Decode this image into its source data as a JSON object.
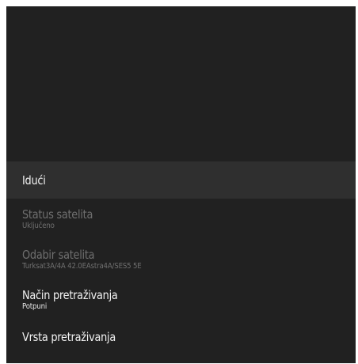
{
  "menu": {
    "items": [
      {
        "title": "Idući",
        "subtitle": "",
        "state": "focused"
      },
      {
        "title": "Status satelita",
        "subtitle": "Uključeno",
        "state": "disabled"
      },
      {
        "title": "Odabir satelita",
        "subtitle": "Turksat3A/4A 42.0EAstra4A/SES5 5E",
        "state": "disabled"
      },
      {
        "title": "Način pretraživanja",
        "subtitle": "Potpuni",
        "state": "enabled"
      },
      {
        "title": "Vrsta pretraživanja",
        "subtitle": "",
        "state": "enabled"
      }
    ]
  },
  "colors": {
    "panel_background": "#212121",
    "focused_row_background": "#2f2f2f",
    "text_enabled": "#f2f2f2",
    "text_disabled": "#6f6f6f"
  }
}
